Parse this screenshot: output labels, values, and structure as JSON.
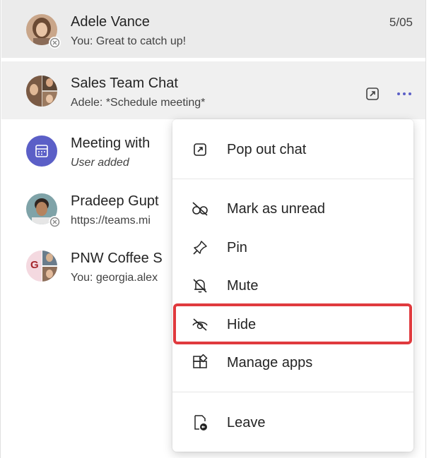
{
  "chats": [
    {
      "name": "Adele Vance",
      "preview": "You: Great to catch up!",
      "time": "5/05"
    },
    {
      "name": "Sales Team Chat",
      "preview": "Adele: *Schedule meeting*"
    },
    {
      "name": "Meeting with",
      "preview": "User added"
    },
    {
      "name": "Pradeep Gupt",
      "preview": "https://teams.mi"
    },
    {
      "name": "PNW Coffee S",
      "preview": "You: georgia.alex",
      "initial": "G"
    }
  ],
  "menu": {
    "items": [
      {
        "label": "Pop out chat",
        "icon": "pop-out-icon"
      },
      {
        "label": "Mark as unread",
        "icon": "mark-unread-icon"
      },
      {
        "label": "Pin",
        "icon": "pin-icon"
      },
      {
        "label": "Mute",
        "icon": "mute-icon"
      },
      {
        "label": "Hide",
        "icon": "hide-icon"
      },
      {
        "label": "Manage apps",
        "icon": "apps-icon"
      },
      {
        "label": "Leave",
        "icon": "leave-icon"
      }
    ]
  },
  "colors": {
    "accent": "#5b5fc7",
    "highlight": "#e03a3e",
    "selected_bg": "#ebebeb"
  }
}
